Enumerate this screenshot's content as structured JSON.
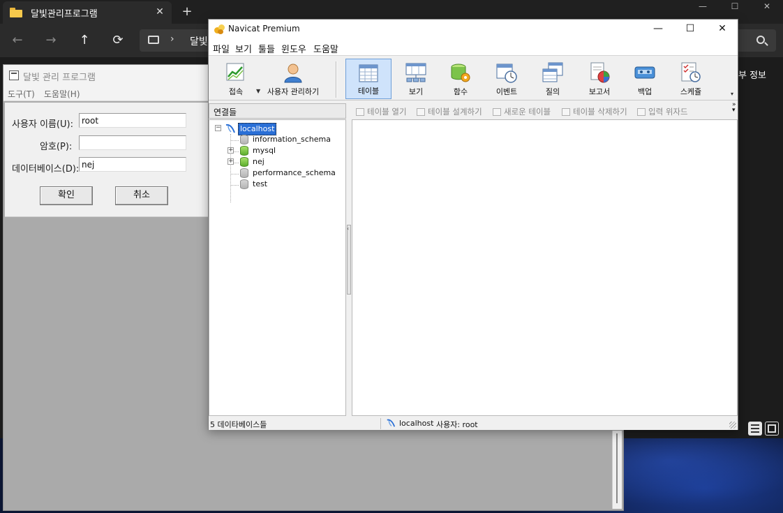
{
  "explorer": {
    "tab_title": "달빛관리프로그램",
    "tab_close": "✕",
    "new_tab": "+",
    "min": "—",
    "max": "☐",
    "close": "✕",
    "nav_back": "←",
    "nav_forward": "→",
    "nav_up": "↑",
    "nav_refresh": "⟳",
    "address_chevron": "›",
    "address_text": "달빛",
    "side_text": "부 정보"
  },
  "app": {
    "title": "달빛 관리 프로그램",
    "menu": [
      "도구(T)",
      "도움말(H)"
    ],
    "login": {
      "username_label": "사용자 이름(U):",
      "username_value": "root",
      "password_label": "암호(P):",
      "password_value": "",
      "database_label": "데이터베이스(D):",
      "database_value": "nej",
      "ok_label": "확인",
      "cancel_label": "취소"
    }
  },
  "navicat": {
    "title": "Navicat Premium",
    "win_min": "—",
    "win_max": "☐",
    "win_close": "✕",
    "menu": [
      "파일",
      "보기",
      "툴들",
      "윈도우",
      "도움말"
    ],
    "toolbar": [
      {
        "label": "접속",
        "icon": "connect-icon"
      },
      {
        "label": "사용자 관리하기",
        "icon": "user-icon"
      },
      {
        "label": "테이블",
        "icon": "table-icon",
        "selected": true
      },
      {
        "label": "보기",
        "icon": "view-icon"
      },
      {
        "label": "함수",
        "icon": "function-icon"
      },
      {
        "label": "이벤트",
        "icon": "event-icon"
      },
      {
        "label": "질의",
        "icon": "query-icon"
      },
      {
        "label": "보고서",
        "icon": "report-icon"
      },
      {
        "label": "백업",
        "icon": "backup-icon"
      },
      {
        "label": "스케쥴",
        "icon": "schedule-icon"
      }
    ],
    "connections_header": "연결들",
    "object_toolbar": [
      "테이블 열기",
      "테이블 설계하기",
      "새로운 테이블",
      "테이블 삭제하기",
      "입력 위자드"
    ],
    "tree": {
      "connection": "localhost",
      "databases": [
        {
          "name": "information_schema",
          "active": false
        },
        {
          "name": "mysql",
          "active": true
        },
        {
          "name": "nej",
          "active": true
        },
        {
          "name": "performance_schema",
          "active": false
        },
        {
          "name": "test",
          "active": false
        }
      ]
    },
    "status": {
      "db_count": "5 데이타베이스들",
      "connection": "localhost",
      "user": "사용자: root"
    }
  },
  "colors": {
    "selection_blue": "#2a6fd6",
    "toolbar_selected": "#cfe3fb",
    "explorer_dark": "#1c1c1c"
  }
}
